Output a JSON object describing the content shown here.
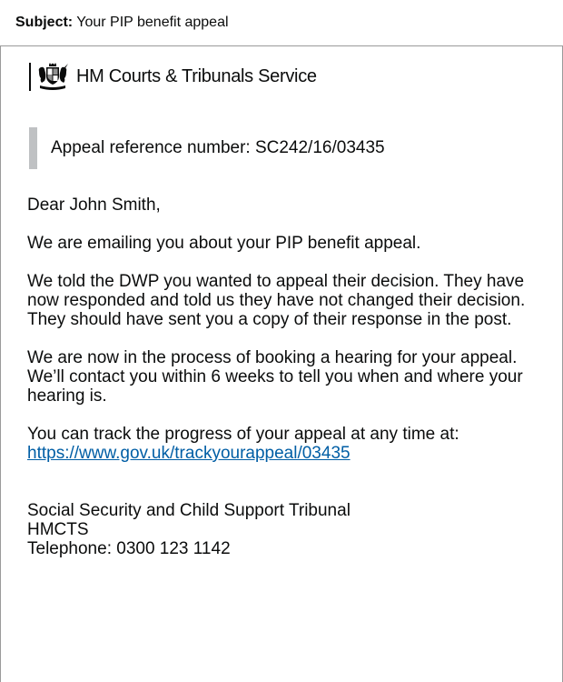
{
  "subject": {
    "label": "Subject:",
    "value": " Your PIP benefit appeal"
  },
  "brand": {
    "name": "HM Courts & Tribunals Service",
    "icon": "royal-crest-icon"
  },
  "reference": {
    "text": "Appeal reference number: SC242/16/03435"
  },
  "letter": {
    "greeting": "Dear John Smith,",
    "paragraph_1": "We are emailing you about your PIP benefit appeal.",
    "paragraph_2": "We told the DWP you wanted to appeal their decision. They have now responded and told us they have not changed their decision. They should have sent you a copy of their response in the post.",
    "paragraph_3": "We are now in the process of booking a hearing for your appeal. We’ll contact you within 6 weeks to tell you when and where your hearing is.",
    "track_intro": "You can track the progress of your appeal at any time at:",
    "track_link": "https://www.gov.uk/trackyourappeal/03435",
    "signoff_line_1": "Social Security and Child Support Tribunal",
    "signoff_line_2": "HMCTS",
    "signoff_line_3": "Telephone: 0300 123 1142"
  },
  "colors": {
    "link": "#005ea5",
    "text": "#0b0c0c",
    "panel_border": "#bfc1c3"
  }
}
